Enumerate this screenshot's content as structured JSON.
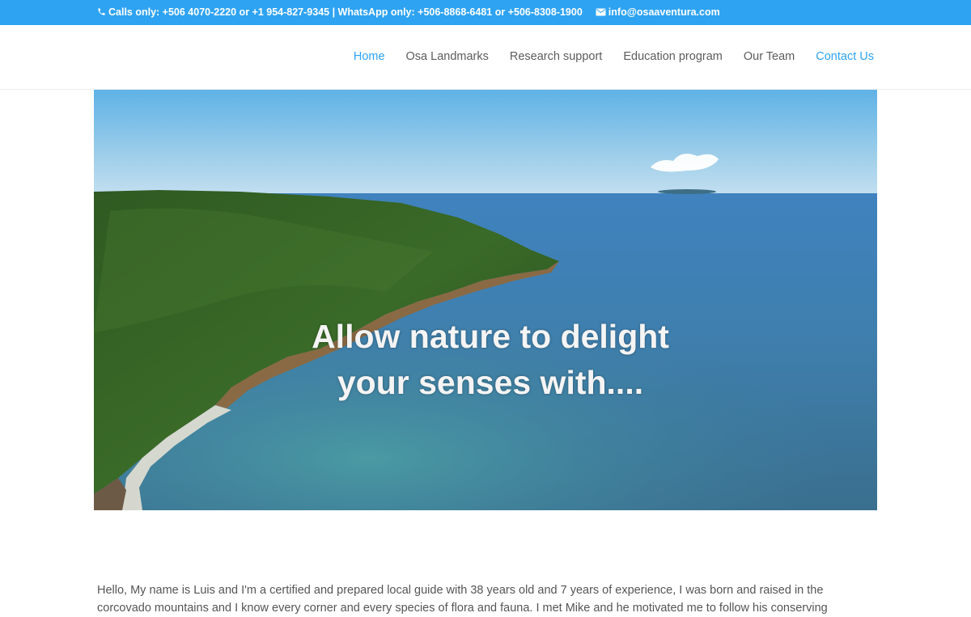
{
  "topbar": {
    "phone_icon": "phone-icon",
    "contact_text": "Calls only: +506 4070-2220 or +1 954-827-9345 | WhatsApp only: +506-8868-6481 or +506-8308-1900",
    "email_icon": "envelope-icon",
    "email": "info@osaaventura.com",
    "background": "#2ea3f2"
  },
  "nav": {
    "items": [
      {
        "label": "Home",
        "active": true
      },
      {
        "label": "Osa Landmarks",
        "active": false
      },
      {
        "label": "Research support",
        "active": false
      },
      {
        "label": "Education program",
        "active": false
      },
      {
        "label": "Our Team",
        "active": false
      },
      {
        "label": "Contact Us",
        "active": true
      }
    ],
    "accent_color": "#2ea3f2",
    "text_color": "#5c5c5c"
  },
  "hero": {
    "caption_line1": "Allow nature to delight",
    "caption_line2": "your senses with...."
  },
  "intro": {
    "text": "Hello, My name is Luis and I'm a certified and prepared local guide with 38 years old and 7 years of experience, I was born and raised in the corcovado mountains and I know every corner and every species of flora and fauna. I met Mike and he motivated me to follow his conserving"
  }
}
